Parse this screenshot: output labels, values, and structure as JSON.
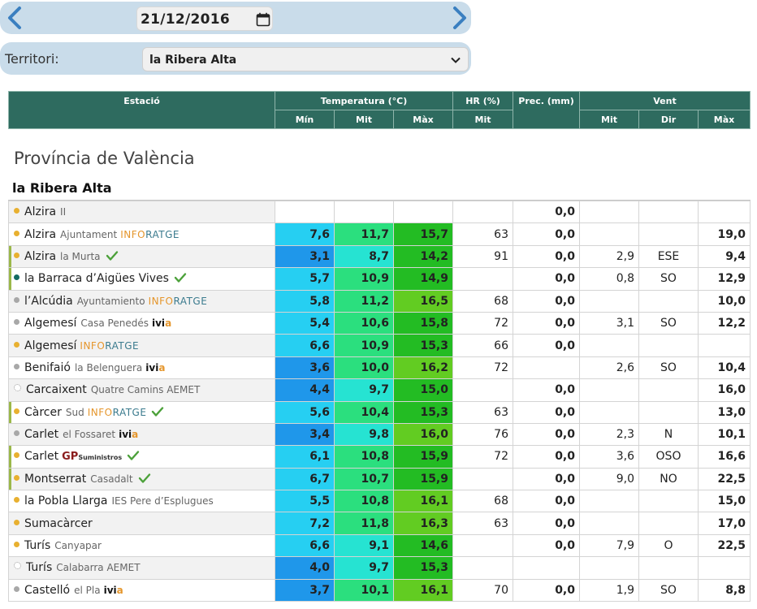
{
  "date": "21/12/2016",
  "territory": {
    "label": "Territori:",
    "selected": "la Ribera Alta"
  },
  "headers": {
    "station": "Estació",
    "temp": "Temperatura (°C)",
    "hr": "HR (%)",
    "prec": "Prec. (mm)",
    "wind": "Vent",
    "min": "Mín",
    "mit": "Mit",
    "max": "Màx",
    "hr_mit": "Mit",
    "w_mit": "Mit",
    "w_dir": "Dir",
    "w_max": "Màx"
  },
  "province": "Província de València",
  "comarca": "la Ribera Alta",
  "colors": {
    "header_bg": "#2e6b5f",
    "dot_yellow": "#e8b030",
    "dot_teal": "#136a63",
    "dot_gray": "#a8a8a8",
    "dot_white": "#ffffff"
  },
  "rows": [
    {
      "dot": "yellow",
      "name": "Alzira",
      "sub": "II",
      "brand": "",
      "check": false,
      "min": "",
      "mit": "",
      "max": "",
      "hr": "",
      "prec": "0,0",
      "wmit": "",
      "wdir": "",
      "wmax": ""
    },
    {
      "dot": "yellow",
      "name": "Alzira",
      "sub": "Ajuntament",
      "brand": "inforatge",
      "check": false,
      "min": "7,6",
      "mit": "11,7",
      "max": "15,7",
      "hr": "63",
      "prec": "0,0",
      "wmit": "",
      "wdir": "",
      "wmax": "19,0"
    },
    {
      "dot": "yellow",
      "name": "Alzira",
      "sub": "la Murta",
      "brand": "",
      "check": true,
      "min": "3,1",
      "mit": "8,7",
      "max": "14,2",
      "hr": "91",
      "prec": "0,0",
      "wmit": "2,9",
      "wdir": "ESE",
      "wmax": "9,4"
    },
    {
      "dot": "teal",
      "name": "la Barraca d’Aigües Vives",
      "sub": "",
      "brand": "",
      "check": true,
      "min": "5,7",
      "mit": "10,9",
      "max": "14,9",
      "hr": "",
      "prec": "0,0",
      "wmit": "0,8",
      "wdir": "SO",
      "wmax": "12,9"
    },
    {
      "dot": "gray",
      "name": "l’Alcúdia",
      "sub": "Ayuntamiento",
      "brand": "inforatge",
      "check": false,
      "min": "5,8",
      "mit": "11,2",
      "max": "16,5",
      "hr": "68",
      "prec": "0,0",
      "wmit": "",
      "wdir": "",
      "wmax": "10,0"
    },
    {
      "dot": "gray",
      "name": "Algemesí",
      "sub": "Casa Penedés",
      "brand": "ivia",
      "check": false,
      "min": "5,4",
      "mit": "10,6",
      "max": "15,8",
      "hr": "72",
      "prec": "0,0",
      "wmit": "3,1",
      "wdir": "SO",
      "wmax": "12,2"
    },
    {
      "dot": "yellow",
      "name": "Algemesí",
      "sub": "",
      "brand": "inforatge",
      "check": false,
      "min": "6,6",
      "mit": "10,9",
      "max": "15,3",
      "hr": "66",
      "prec": "0,0",
      "wmit": "",
      "wdir": "",
      "wmax": ""
    },
    {
      "dot": "gray",
      "name": "Benifaió",
      "sub": "la Belenguera",
      "brand": "ivia",
      "check": false,
      "min": "3,6",
      "mit": "10,0",
      "max": "16,2",
      "hr": "72",
      "prec": "",
      "wmit": "2,6",
      "wdir": "SO",
      "wmax": "10,4"
    },
    {
      "dot": "white",
      "name": "Carcaixent",
      "sub": "Quatre Camins AEMET",
      "brand": "",
      "check": false,
      "min": "4,4",
      "mit": "9,7",
      "max": "15,0",
      "hr": "",
      "prec": "0,0",
      "wmit": "",
      "wdir": "",
      "wmax": "16,0"
    },
    {
      "dot": "yellow",
      "name": "Càrcer",
      "sub": "Sud",
      "brand": "inforatge",
      "check": true,
      "min": "5,6",
      "mit": "10,4",
      "max": "15,3",
      "hr": "63",
      "prec": "0,0",
      "wmit": "",
      "wdir": "",
      "wmax": "13,0"
    },
    {
      "dot": "gray",
      "name": "Carlet",
      "sub": "el Fossaret",
      "brand": "ivia",
      "check": false,
      "min": "3,4",
      "mit": "9,8",
      "max": "16,0",
      "hr": "76",
      "prec": "0,0",
      "wmit": "2,3",
      "wdir": "N",
      "wmax": "10,1"
    },
    {
      "dot": "yellow",
      "name": "Carlet",
      "sub": "",
      "brand": "gp",
      "check": true,
      "min": "6,1",
      "mit": "10,8",
      "max": "15,9",
      "hr": "72",
      "prec": "0,0",
      "wmit": "3,6",
      "wdir": "OSO",
      "wmax": "16,6"
    },
    {
      "dot": "yellow",
      "name": "Montserrat",
      "sub": "Casadalt",
      "brand": "",
      "check": true,
      "min": "6,7",
      "mit": "10,7",
      "max": "15,9",
      "hr": "",
      "prec": "0,0",
      "wmit": "9,0",
      "wdir": "NO",
      "wmax": "22,5"
    },
    {
      "dot": "yellow",
      "name": "la Pobla Llarga",
      "sub": "IES Pere d’Esplugues",
      "brand": "",
      "check": false,
      "min": "5,5",
      "mit": "10,8",
      "max": "16,1",
      "hr": "68",
      "prec": "0,0",
      "wmit": "",
      "wdir": "",
      "wmax": "15,0"
    },
    {
      "dot": "yellow",
      "name": "Sumacàrcer",
      "sub": "",
      "brand": "",
      "check": false,
      "min": "7,2",
      "mit": "11,8",
      "max": "16,3",
      "hr": "63",
      "prec": "0,0",
      "wmit": "",
      "wdir": "",
      "wmax": "17,0"
    },
    {
      "dot": "yellow",
      "name": "Turís",
      "sub": "Canyapar",
      "brand": "",
      "check": false,
      "min": "6,6",
      "mit": "9,1",
      "max": "14,6",
      "hr": "",
      "prec": "0,0",
      "wmit": "7,9",
      "wdir": "O",
      "wmax": "22,5"
    },
    {
      "dot": "white",
      "name": "Turís",
      "sub": "Calabarra AEMET",
      "brand": "",
      "check": false,
      "min": "4,0",
      "mit": "9,7",
      "max": "15,3",
      "hr": "",
      "prec": "",
      "wmit": "",
      "wdir": "",
      "wmax": ""
    },
    {
      "dot": "gray",
      "name": "Castelló",
      "sub": "el Pla",
      "brand": "ivia",
      "check": false,
      "min": "3,7",
      "mit": "10,1",
      "max": "16,1",
      "hr": "70",
      "prec": "0,0",
      "wmit": "1,9",
      "wdir": "SO",
      "wmax": "8,8"
    }
  ],
  "brands": {
    "inforatge_a": "INFO",
    "inforatge_b": "RATGE",
    "ivia_a": "ivi",
    "ivia_b": "a",
    "gp_a": "GP",
    "gp_b": "Suministros"
  }
}
